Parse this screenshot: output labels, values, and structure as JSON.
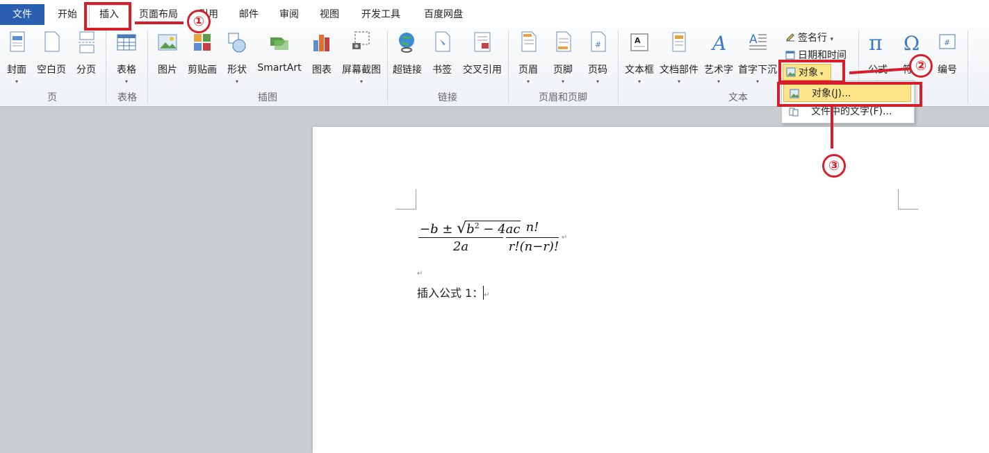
{
  "tabs": [
    "文件",
    "开始",
    "插入",
    "页面布局",
    "引用",
    "邮件",
    "审阅",
    "视图",
    "开发工具",
    "百度网盘"
  ],
  "ribbon": {
    "page": {
      "cover": "封面",
      "blank": "空白页",
      "break": "分页",
      "group": "页"
    },
    "table": {
      "table": "表格",
      "group": "表格"
    },
    "illustrations": {
      "picture": "图片",
      "clipart": "剪贴画",
      "shapes": "形状",
      "smartart": "SmartArt",
      "chart": "图表",
      "screenshot": "屏幕截图",
      "group": "插图"
    },
    "links": {
      "hyperlink": "超链接",
      "bookmark": "书签",
      "crossref": "交叉引用",
      "group": "链接"
    },
    "headerfooter": {
      "header": "页眉",
      "footer": "页脚",
      "pagenum": "页码",
      "group": "页眉和页脚"
    },
    "text": {
      "textbox": "文本框",
      "quickparts": "文档部件",
      "wordart": "艺术字",
      "dropcap": "首字下沉",
      "signature": "签名行",
      "datetime": "日期和时间",
      "object": "对象",
      "group": "文本"
    },
    "symbols": {
      "equation": "公式",
      "symbol": "符号",
      "number": "编号"
    }
  },
  "dropdown": {
    "item1": "对象(J)...",
    "item2": "文件中的文字(F)..."
  },
  "document": {
    "line_label": "插入公式 1：",
    "frac1": {
      "num_a": "−b ± ",
      "num_b": "b",
      "num_exp": "2",
      "num_c": " − 4ac",
      "den": "2a"
    },
    "frac2": {
      "num": "n!",
      "den": "r!(n−r)!"
    }
  },
  "annotations": [
    "①",
    "②",
    "③"
  ],
  "colors": {
    "accent": "#2a5fb0",
    "annotation": "#d71f2b",
    "highlight": "#fde489"
  }
}
